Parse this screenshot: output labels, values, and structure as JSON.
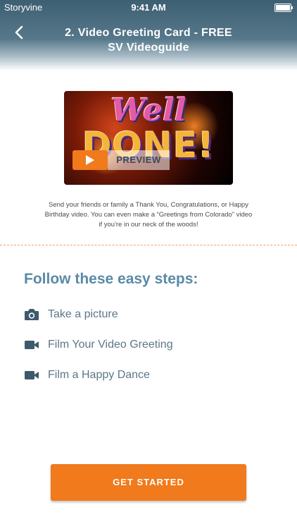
{
  "status_bar": {
    "carrier": "Storyvine",
    "time": "9:41 AM"
  },
  "header": {
    "title_line1": "2. Video Greeting Card - FREE",
    "title_line2": "SV Videoguide"
  },
  "video": {
    "headline_top": "Well",
    "headline_bottom": "DONE!",
    "preview_label": "PREVIEW"
  },
  "description": "Send your friends or family a Thank You, Congratulations, or Happy Birthday video. You can even make a “Greetings from Colorado” video if you're in our neck of the woods!",
  "steps": {
    "heading": "Follow these easy steps:",
    "items": [
      {
        "label": "Take a picture",
        "icon": "camera-icon"
      },
      {
        "label": "Film Your Video Greeting",
        "icon": "video-camera-icon"
      },
      {
        "label": "Film a Happy Dance",
        "icon": "video-camera-icon"
      }
    ]
  },
  "cta": {
    "label": "GET STARTED"
  },
  "colors": {
    "accent": "#f07a1c",
    "heading": "#5b8aa6",
    "header": "#3d5f72"
  }
}
